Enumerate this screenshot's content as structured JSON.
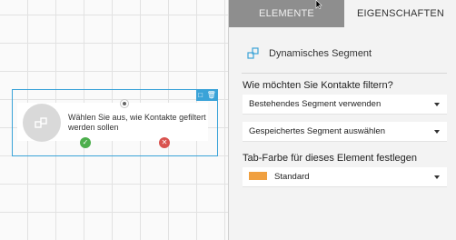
{
  "canvas": {
    "node": {
      "text": "Wählen Sie aus, wie Kontakte gefiltert werden sollen",
      "toolbar_icons": [
        "document-icon",
        "trash-icon"
      ]
    }
  },
  "panel": {
    "tabs": [
      {
        "label": "ELEMENTE",
        "active": false
      },
      {
        "label": "EIGENSCHAFTEN",
        "active": true
      }
    ],
    "section_title": "Dynamisches Segment",
    "filter_label": "Wie möchten Sie Kontakte filtern?",
    "filter_select_1": "Bestehendes Segment verwenden",
    "filter_select_2": "Gespeichertes Segment auswählen",
    "color_label": "Tab-Farbe für dieses Element festlegen",
    "color_select": "Standard",
    "color_swatch": "#f0a040"
  },
  "colors": {
    "accent": "#3aa3d8",
    "yes": "#4cae4c",
    "no": "#d9534f"
  }
}
